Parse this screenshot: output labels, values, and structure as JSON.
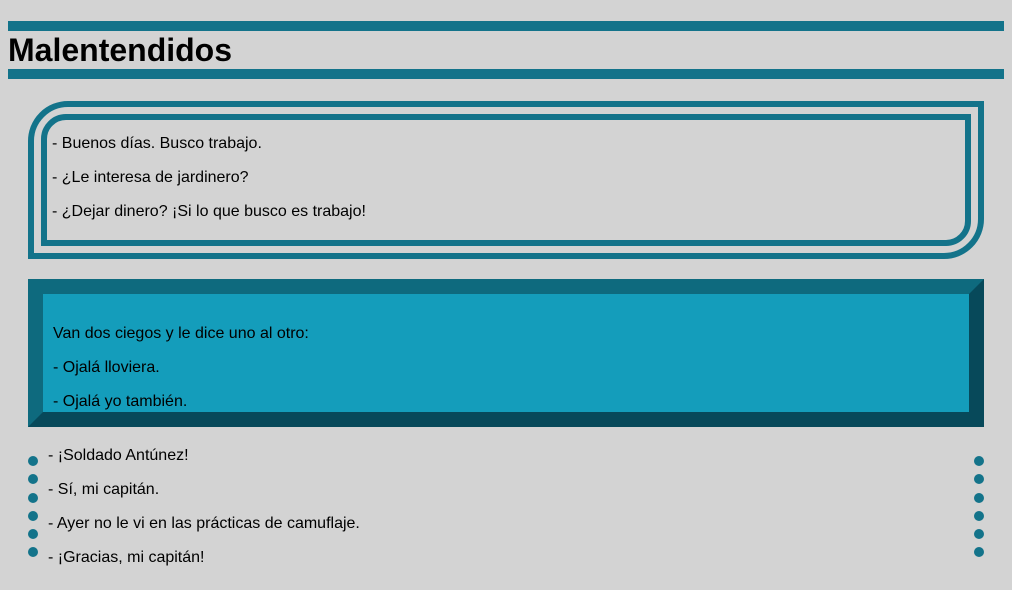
{
  "title": "Malentendidos",
  "jokes": [
    {
      "lines": [
        "- Buenos días. Busco trabajo.",
        "- ¿Le interesa de jardinero?",
        "- ¿Dejar dinero? ¡Si lo que busco es trabajo!"
      ]
    },
    {
      "lines": [
        "Van dos ciegos y le dice uno al otro:",
        "- Ojalá lloviera.",
        "- Ojalá yo también."
      ]
    },
    {
      "lines": [
        "- ¡Soldado Antúnez!",
        "- Sí, mi capitán.",
        "- Ayer no le vi en las prácticas de camuflaje.",
        "- ¡Gracias, mi capitán!"
      ]
    }
  ],
  "colors": {
    "accent": "#13738a",
    "box_fill": "#149dbb",
    "page_background": "#d3d3d3"
  }
}
